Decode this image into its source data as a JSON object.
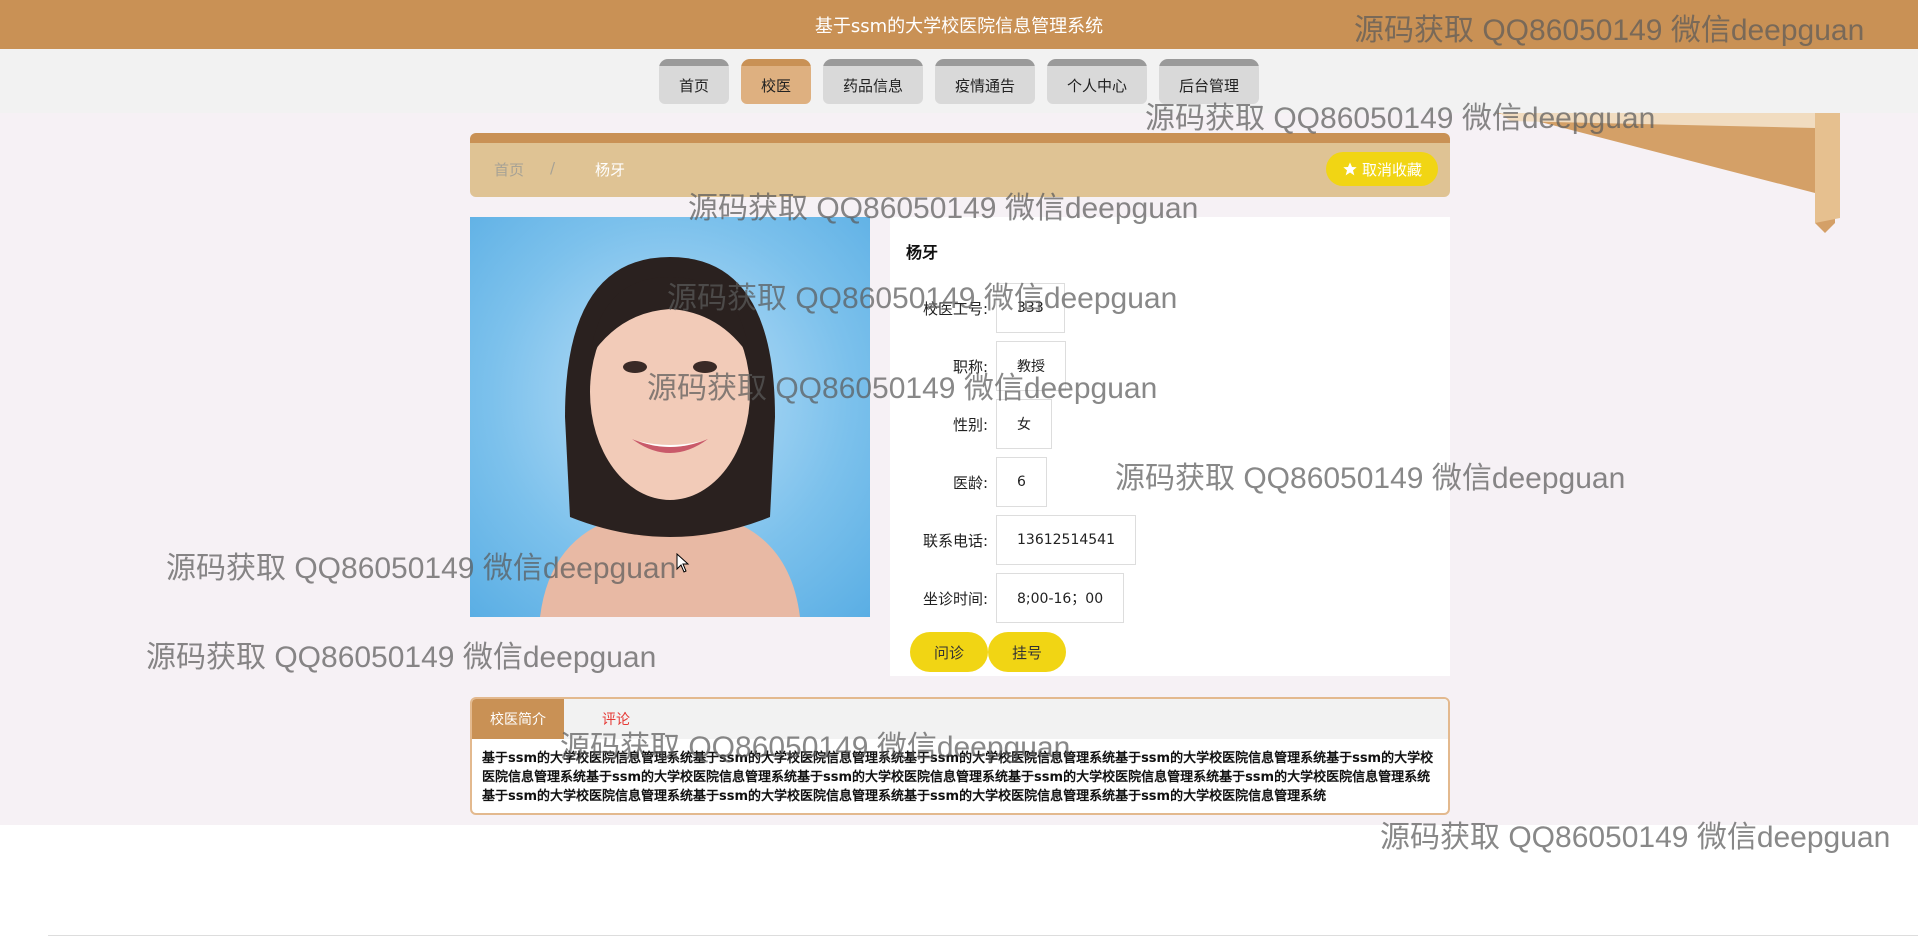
{
  "header": {
    "title": "基于ssm的大学校医院信息管理系统"
  },
  "nav": [
    {
      "label": "首页",
      "active": false
    },
    {
      "label": "校医",
      "active": true
    },
    {
      "label": "药品信息",
      "active": false
    },
    {
      "label": "疫情通告",
      "active": false
    },
    {
      "label": "个人中心",
      "active": false
    },
    {
      "label": "后台管理",
      "active": false
    }
  ],
  "breadcrumb": {
    "home": "首页",
    "separator": "/",
    "current": "杨牙"
  },
  "favorite": {
    "label": "取消收藏",
    "icon": "star-icon"
  },
  "doctor": {
    "name": "杨牙",
    "fields": [
      {
        "label": "校医工号:",
        "value": "333"
      },
      {
        "label": "职称:",
        "value": "教授"
      },
      {
        "label": "性别:",
        "value": "女"
      },
      {
        "label": "医龄:",
        "value": "6"
      },
      {
        "label": "联系电话:",
        "value": "13612514541"
      },
      {
        "label": "坐诊时间:",
        "value": "8;00-16；00"
      }
    ]
  },
  "actions": {
    "consult": "问诊",
    "register": "挂号"
  },
  "tabs": {
    "intro": "校医简介",
    "comments": "评论"
  },
  "intro_text": "基于ssm的大学校医院信息管理系统基于ssm的大学校医院信息管理系统基于ssm的大学校医院信息管理系统基于ssm的大学校医院信息管理系统基于ssm的大学校医院信息管理系统基于ssm的大学校医院信息管理系统基于ssm的大学校医院信息管理系统基于ssm的大学校医院信息管理系统基于ssm的大学校医院信息管理系统基于ssm的大学校医院信息管理系统基于ssm的大学校医院信息管理系统基于ssm的大学校医院信息管理系统基于ssm的大学校医院信息管理系统",
  "watermark": "源码获取 QQ86050149 微信deepguan",
  "colors": {
    "primary": "#c99155",
    "accent": "#f1d514",
    "breadcrumb_bg": "#dfc394"
  }
}
